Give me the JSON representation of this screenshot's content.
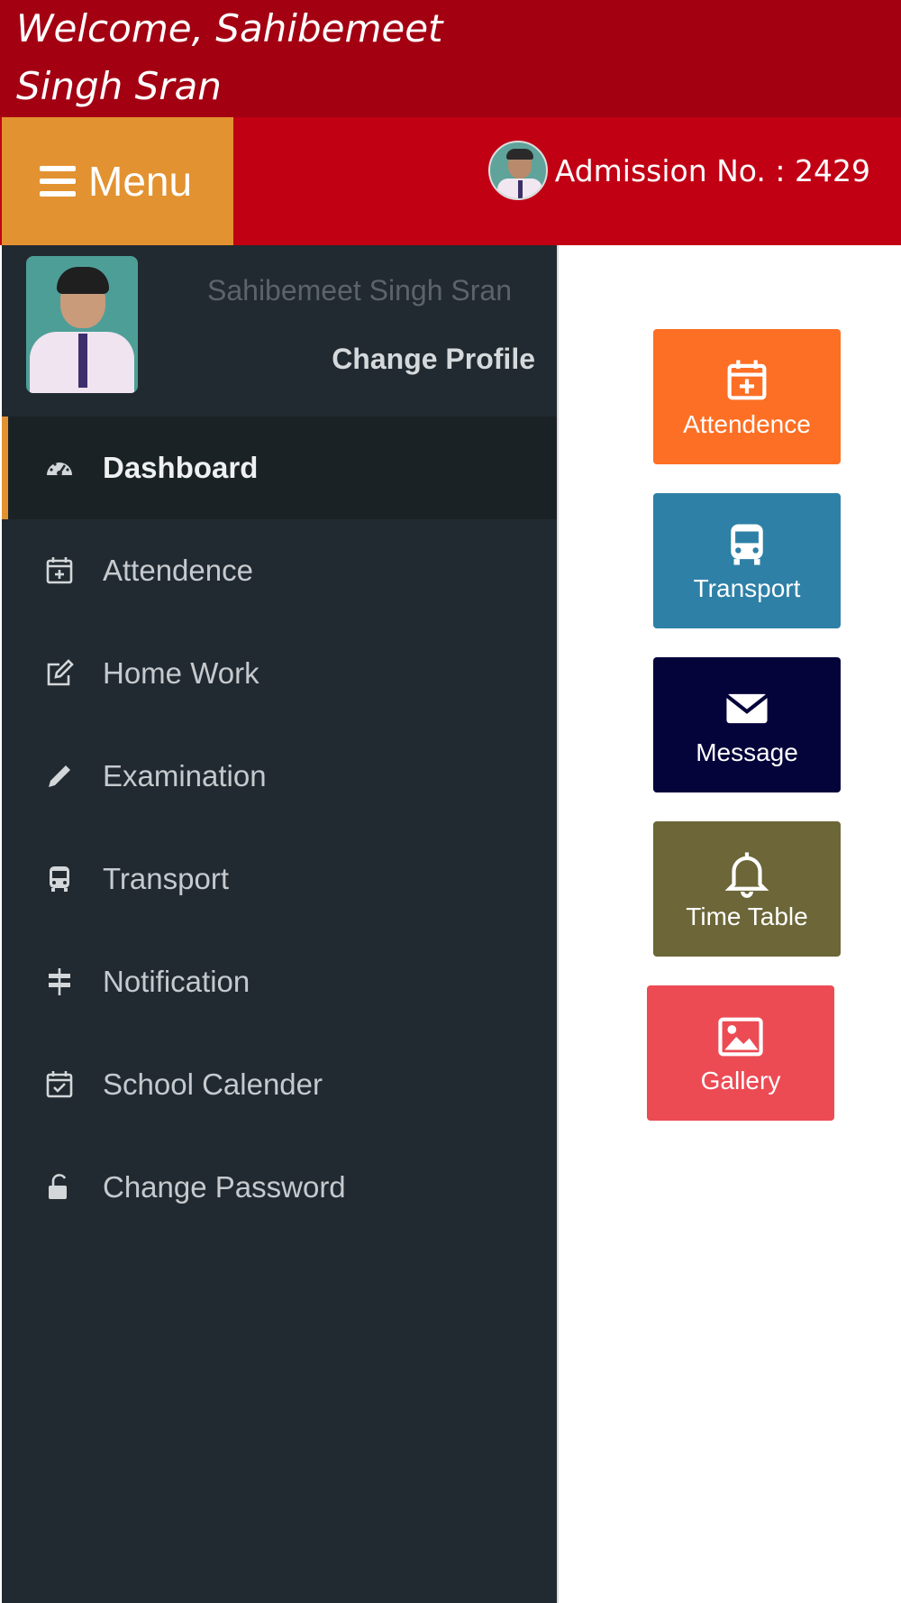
{
  "welcome": {
    "text": "Welcome, Sahibemeet Singh Sran"
  },
  "header": {
    "menu_label": "Menu",
    "admission_label": "Admission No. : 2429"
  },
  "profile": {
    "name": "Sahibemeet Singh Sran",
    "change_profile_label": "Change Profile"
  },
  "sidebar": {
    "items": [
      {
        "label": "Dashboard",
        "icon": "dashboard-icon",
        "active": true
      },
      {
        "label": "Attendence",
        "icon": "calendar-plus-icon",
        "active": false
      },
      {
        "label": "Home Work",
        "icon": "edit-icon",
        "active": false
      },
      {
        "label": "Examination",
        "icon": "pencil-icon",
        "active": false
      },
      {
        "label": "Transport",
        "icon": "bus-icon",
        "active": false
      },
      {
        "label": "Notification",
        "icon": "signpost-icon",
        "active": false
      },
      {
        "label": "School Calender",
        "icon": "calendar-check-icon",
        "active": false
      },
      {
        "label": "Change Password",
        "icon": "unlock-icon",
        "active": false
      }
    ]
  },
  "tiles": [
    {
      "label": "Attendence",
      "icon": "calendar-plus-icon",
      "color": "#fd6f24"
    },
    {
      "label": "Transport",
      "icon": "bus-icon",
      "color": "#2e80a6"
    },
    {
      "label": "Message",
      "icon": "envelope-icon",
      "color": "#04033a"
    },
    {
      "label": "Time Table",
      "icon": "bell-icon",
      "color": "#6c6638"
    },
    {
      "label": "Gallery",
      "icon": "image-icon",
      "color": "#ec4b54"
    }
  ],
  "colors": {
    "welcome_bar": "#a30012",
    "header_bar": "#c10014",
    "menu_button": "#e39231",
    "sidebar": "#212a30",
    "active_indicator": "#e39231"
  }
}
